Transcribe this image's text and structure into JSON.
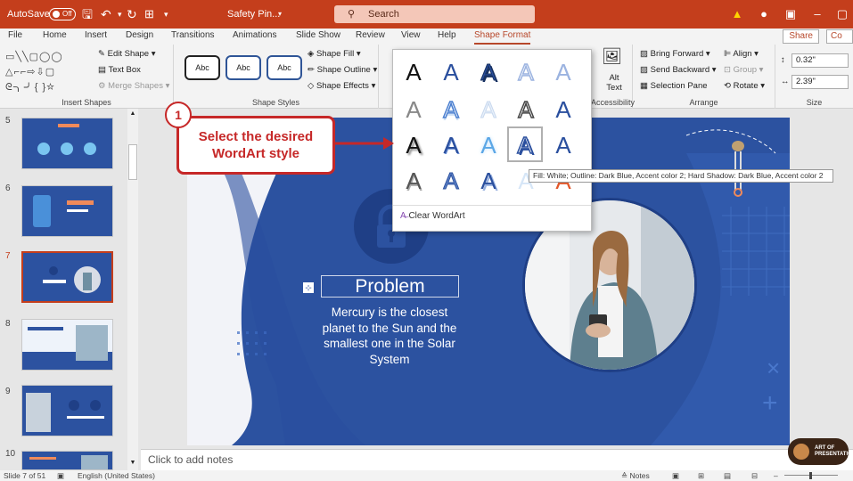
{
  "titlebar": {
    "autosave_label": "AutoSave",
    "autosave_state": "Off",
    "doc_title": "Safety Pin...",
    "search_placeholder": "Search"
  },
  "menu": {
    "tabs": [
      "File",
      "Home",
      "Insert",
      "Design",
      "Transitions",
      "Animations",
      "Slide Show",
      "Review",
      "View",
      "Help",
      "Shape Format"
    ],
    "active_tab": "Shape Format",
    "share_label": "Share",
    "comments_label": "Co"
  },
  "ribbon": {
    "insert_shapes": {
      "edit_shape": "Edit Shape",
      "text_box": "Text Box",
      "merge_shapes": "Merge Shapes",
      "label": "Insert Shapes"
    },
    "shape_styles": {
      "abc": "Abc",
      "shape_fill": "Shape Fill",
      "shape_outline": "Shape Outline",
      "shape_effects": "Shape Effects",
      "label": "Shape Styles"
    },
    "accessibility": {
      "alt_text": "Alt Text",
      "label": "Accessibility"
    },
    "arrange": {
      "bring_forward": "Bring Forward",
      "send_backward": "Send Backward",
      "selection_pane": "Selection Pane",
      "align": "Align",
      "group": "Group",
      "rotate": "Rotate",
      "label": "Arrange"
    },
    "size": {
      "height": "0.32\"",
      "width": "2.39\"",
      "label": "Size"
    }
  },
  "wordart": {
    "glyph": "A",
    "clear_label": "Clear WordArt",
    "tooltip": "Fill: White; Outline: Dark Blue, Accent color 2; Hard Shadow: Dark Blue, Accent color 2"
  },
  "callout": {
    "step": "1",
    "text": "Select the desired WordArt style"
  },
  "slides": {
    "numbers": [
      "5",
      "6",
      "7",
      "8",
      "9",
      "10"
    ],
    "active": "7"
  },
  "slide": {
    "heading": "Problem",
    "body": "Mercury is the closest planet to the Sun and the smallest one in the Solar System"
  },
  "notes_placeholder": "Click to add notes",
  "status": {
    "slide_info": "Slide 7 of 51",
    "language": "English (United States)",
    "notes_label": "Notes"
  },
  "logo_text": "ART OF PRESENTATIONS"
}
